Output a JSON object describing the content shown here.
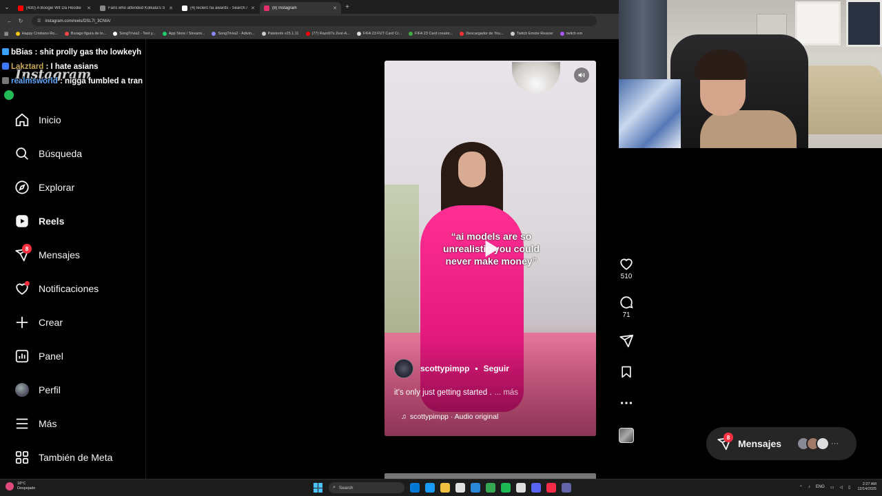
{
  "browser": {
    "tabs": [
      {
        "title": "(430) A Boogie Wit Da Hoodie",
        "color": "#ff0000",
        "active": false
      },
      {
        "title": "Fans who attended Kolkata's S",
        "color": "#888888",
        "active": false
      },
      {
        "title": "(4) leclerc fia awards - Search /",
        "color": "#ffffff",
        "active": false
      },
      {
        "title": "(8) Instagram",
        "color": "#e1306c",
        "active": true
      }
    ],
    "url": "instagram.com/reels/DSL7I_3CNIA/",
    "bookmarks": [
      {
        "label": "Happy Cristiano Ro...",
        "color": "#f5c518"
      },
      {
        "label": "Burago figura de to...",
        "color": "#ff4444"
      },
      {
        "label": "SongTrivia2 - Test y...",
        "color": "#ffffff"
      },
      {
        "label": "App Store / Streami...",
        "color": "#22cc66"
      },
      {
        "label": "SongTrivia2 - Adivin...",
        "color": "#8888ff"
      },
      {
        "label": "Paletools v25.1.11",
        "color": "#cccccc"
      },
      {
        "label": "(77) Razo97s Zest-A...",
        "color": "#ff0000"
      },
      {
        "label": "FIFA 23 FUT Card Cr...",
        "color": "#dddddd"
      },
      {
        "label": "FIFA 23 Card creator...",
        "color": "#44aa44"
      },
      {
        "label": "Descargador de You...",
        "color": "#ff3333"
      },
      {
        "label": "Twitch Emote Resizer",
        "color": "#cccccc"
      },
      {
        "label": "twitch em",
        "color": "#aa55ff"
      }
    ]
  },
  "chat": [
    {
      "user": "bBias",
      "text": " : shit prolly gas tho lowkeyh",
      "user_color": "#ffffff",
      "badge": "#3aa0ff"
    },
    {
      "user": "Lakztard",
      "text": " : I hate asians",
      "user_color": "#c8a850",
      "badge": "#3a7bff"
    },
    {
      "user": "realmsworld",
      "text": " : nigga fumbled a tran",
      "user_color": "#5fa8ff",
      "badge": "#777777"
    }
  ],
  "instagram": {
    "logo": "Instagram",
    "nav": [
      {
        "label": "Inicio",
        "icon": "home-icon"
      },
      {
        "label": "Búsqueda",
        "icon": "search-icon"
      },
      {
        "label": "Explorar",
        "icon": "compass-icon"
      },
      {
        "label": "Reels",
        "icon": "reels-icon"
      },
      {
        "label": "Mensajes",
        "icon": "messenger-icon",
        "badge": "8"
      },
      {
        "label": "Notificaciones",
        "icon": "heart-icon"
      },
      {
        "label": "Crear",
        "icon": "plus-icon"
      },
      {
        "label": "Panel",
        "icon": "dashboard-icon"
      },
      {
        "label": "Perfil",
        "icon": "avatar"
      },
      {
        "label": "Más",
        "icon": "menu-icon"
      },
      {
        "label": "También de Meta",
        "icon": "meta-icon"
      }
    ],
    "reel": {
      "caption_overlay": "“ai models are so\nunrealistic you could\nnever make money”",
      "username": "scottypimpp",
      "separator": "•",
      "follow": "Seguir",
      "description": "it's only just getting started .",
      "more": "... más",
      "audio": "scottypimpp · Audio original"
    },
    "actions": {
      "likes": "510",
      "comments": "71"
    },
    "messages_pill": {
      "label": "Mensajes",
      "badge": "8"
    }
  },
  "taskbar": {
    "weather_temp": "18°C",
    "weather_desc": "Despejado",
    "search": "Search",
    "lang": "ENG",
    "time": "2:27 AM",
    "date": "12/14/2025",
    "apps": [
      "#0078d4",
      "#1a9bfc",
      "#f0c040",
      "#e0e0e0",
      "#2b88d8",
      "#34a853",
      "#1db954",
      "#dddddd",
      "#5865f2",
      "#fa2d48",
      "#6264a7"
    ]
  }
}
